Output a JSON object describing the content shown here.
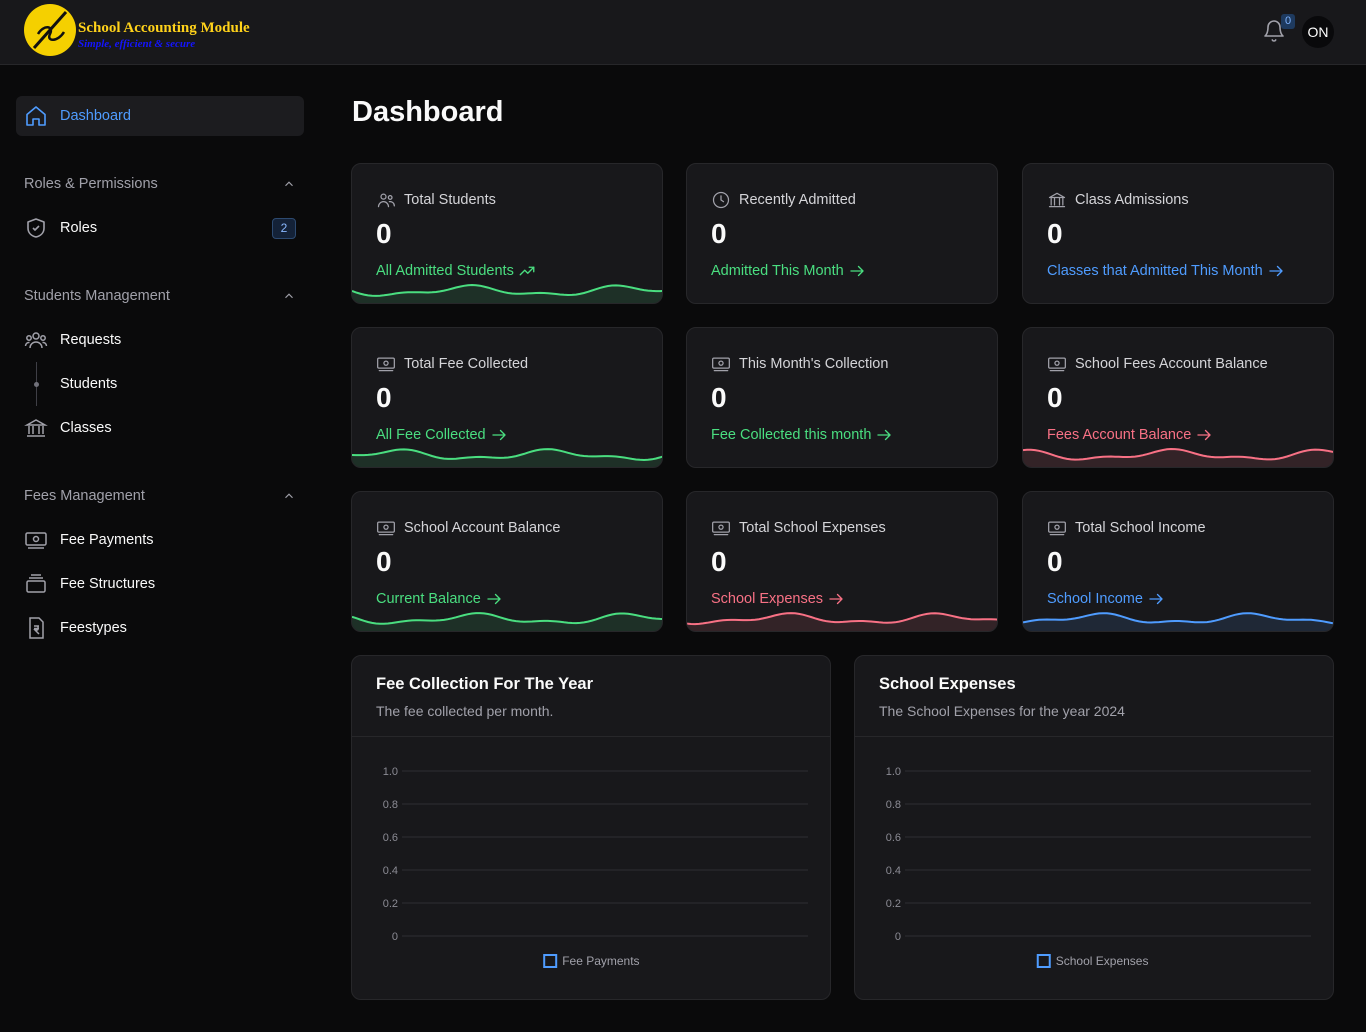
{
  "app": {
    "title": "School Accounting Module",
    "tagline": "Simple, efficient & secure",
    "notification_count": "0",
    "avatar_initials": "ON"
  },
  "sidebar": {
    "dashboard": "Dashboard",
    "sections": [
      {
        "label": "Roles & Permissions",
        "items": [
          {
            "label": "Roles",
            "count": "2",
            "icon": "shield-check-icon"
          }
        ]
      },
      {
        "label": "Students Management",
        "items": [
          {
            "label": "Requests",
            "icon": "users-icon"
          },
          {
            "label": "Students",
            "icon": "tree-dot"
          },
          {
            "label": "Classes",
            "icon": "building-columns-icon"
          }
        ]
      },
      {
        "label": "Fees Management",
        "items": [
          {
            "label": "Fee Payments",
            "icon": "banknote-icon"
          },
          {
            "label": "Fee Structures",
            "icon": "layers-icon"
          },
          {
            "label": "Feestypes",
            "icon": "rupee-file-icon"
          }
        ]
      }
    ]
  },
  "main": {
    "title": "Dashboard",
    "cards": [
      {
        "label": "Total Students",
        "value": "0",
        "link": "All Admitted Students",
        "color": "#4ade80",
        "icon": "users-icon",
        "wave": true,
        "link_icon": "trending-up-icon"
      },
      {
        "label": "Recently Admitted",
        "value": "0",
        "link": "Admitted This Month",
        "color": "#4ade80",
        "icon": "clock-icon",
        "wave": false,
        "link_icon": "arrow-right-icon"
      },
      {
        "label": "Class Admissions",
        "value": "0",
        "link": "Classes that Admitted This Month",
        "color": "#4f9cff",
        "icon": "building-columns-icon",
        "wave": false,
        "link_icon": "arrow-right-icon"
      },
      {
        "label": "Total Fee Collected",
        "value": "0",
        "link": "All Fee Collected",
        "color": "#4ade80",
        "icon": "banknote-icon",
        "wave": true,
        "link_icon": "arrow-right-icon"
      },
      {
        "label": "This Month's Collection",
        "value": "0",
        "link": "Fee Collected this month",
        "color": "#4ade80",
        "icon": "banknote-icon",
        "wave": false,
        "link_icon": "arrow-right-icon"
      },
      {
        "label": "School Fees Account Balance",
        "value": "0",
        "link": "Fees Account Balance",
        "color": "#f87185",
        "icon": "banknote-icon",
        "wave": true,
        "link_icon": "arrow-right-icon"
      },
      {
        "label": "School Account Balance",
        "value": "0",
        "link": "Current Balance",
        "color": "#4ade80",
        "icon": "banknote-icon",
        "wave": true,
        "link_icon": "arrow-right-icon"
      },
      {
        "label": "Total School Expenses",
        "value": "0",
        "link": "School Expenses",
        "color": "#f87185",
        "icon": "banknote-icon",
        "wave": true,
        "link_icon": "arrow-right-icon"
      },
      {
        "label": "Total School Income",
        "value": "0",
        "link": "School Income",
        "color": "#4f9cff",
        "icon": "banknote-icon",
        "wave": true,
        "link_icon": "arrow-right-icon"
      }
    ]
  },
  "chart_data": [
    {
      "type": "bar",
      "title": "Fee Collection For The Year",
      "subtitle": "The fee collected per month.",
      "series": [
        {
          "name": "Fee Payments",
          "values": []
        }
      ],
      "ylim": [
        0,
        1.0
      ],
      "yticks": [
        "0",
        "0.2",
        "0.4",
        "0.6",
        "0.8",
        "1.0"
      ],
      "grid": true,
      "legend": "bottom-center",
      "color": "#4f9cff"
    },
    {
      "type": "bar",
      "title": "School Expenses",
      "subtitle": "The School Expenses for the year 2024",
      "series": [
        {
          "name": "School Expenses",
          "values": []
        }
      ],
      "ylim": [
        0,
        1.0
      ],
      "yticks": [
        "0",
        "0.2",
        "0.4",
        "0.6",
        "0.8",
        "1.0"
      ],
      "grid": true,
      "legend": "bottom-center",
      "color": "#4f9cff"
    }
  ]
}
